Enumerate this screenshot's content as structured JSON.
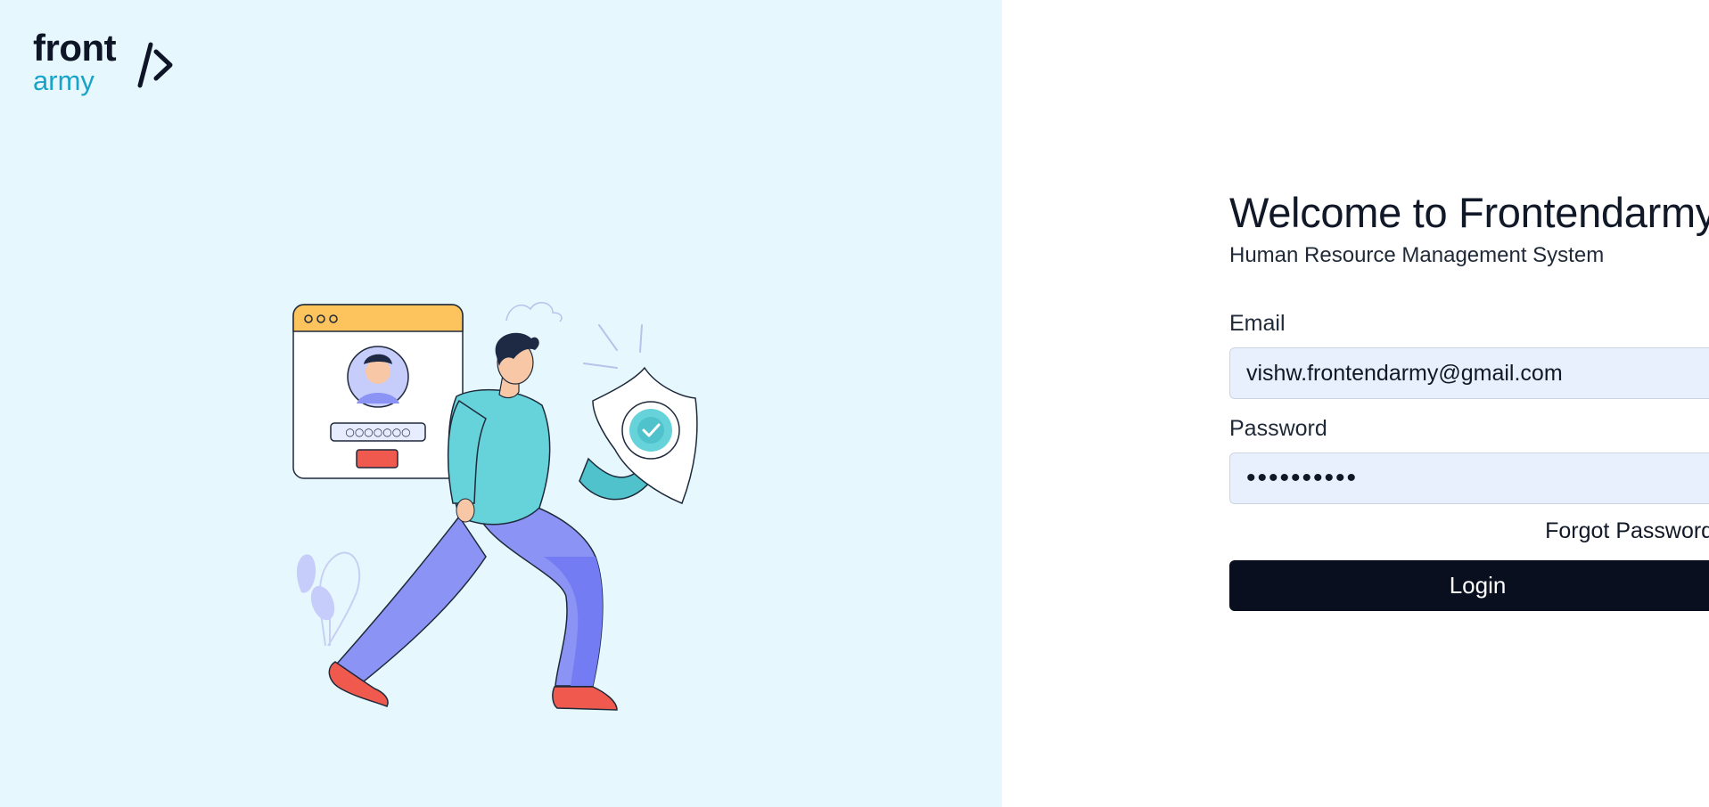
{
  "brand": {
    "logo_word_1": "front",
    "logo_word_2": "army",
    "logo_mark": "/>",
    "primary_color": "#0d1526",
    "accent_color": "#1aa3c8"
  },
  "left_panel": {
    "background_color": "#e6f8fd",
    "illustration": "person-with-shield-login-illustration",
    "illustration_password_dots": "○○○○○○○"
  },
  "form": {
    "title": "Welcome to Frontendarmy",
    "subtitle": "Human Resource Management System",
    "email": {
      "label": "Email",
      "value": "vishw.frontendarmy@gmail.com"
    },
    "password": {
      "label": "Password",
      "value": "••••••••••"
    },
    "forgot_password_label": "Forgot Password?",
    "login_label": "Login",
    "input_background": "#e8f0fe",
    "button_color": "#0a0f1f"
  }
}
